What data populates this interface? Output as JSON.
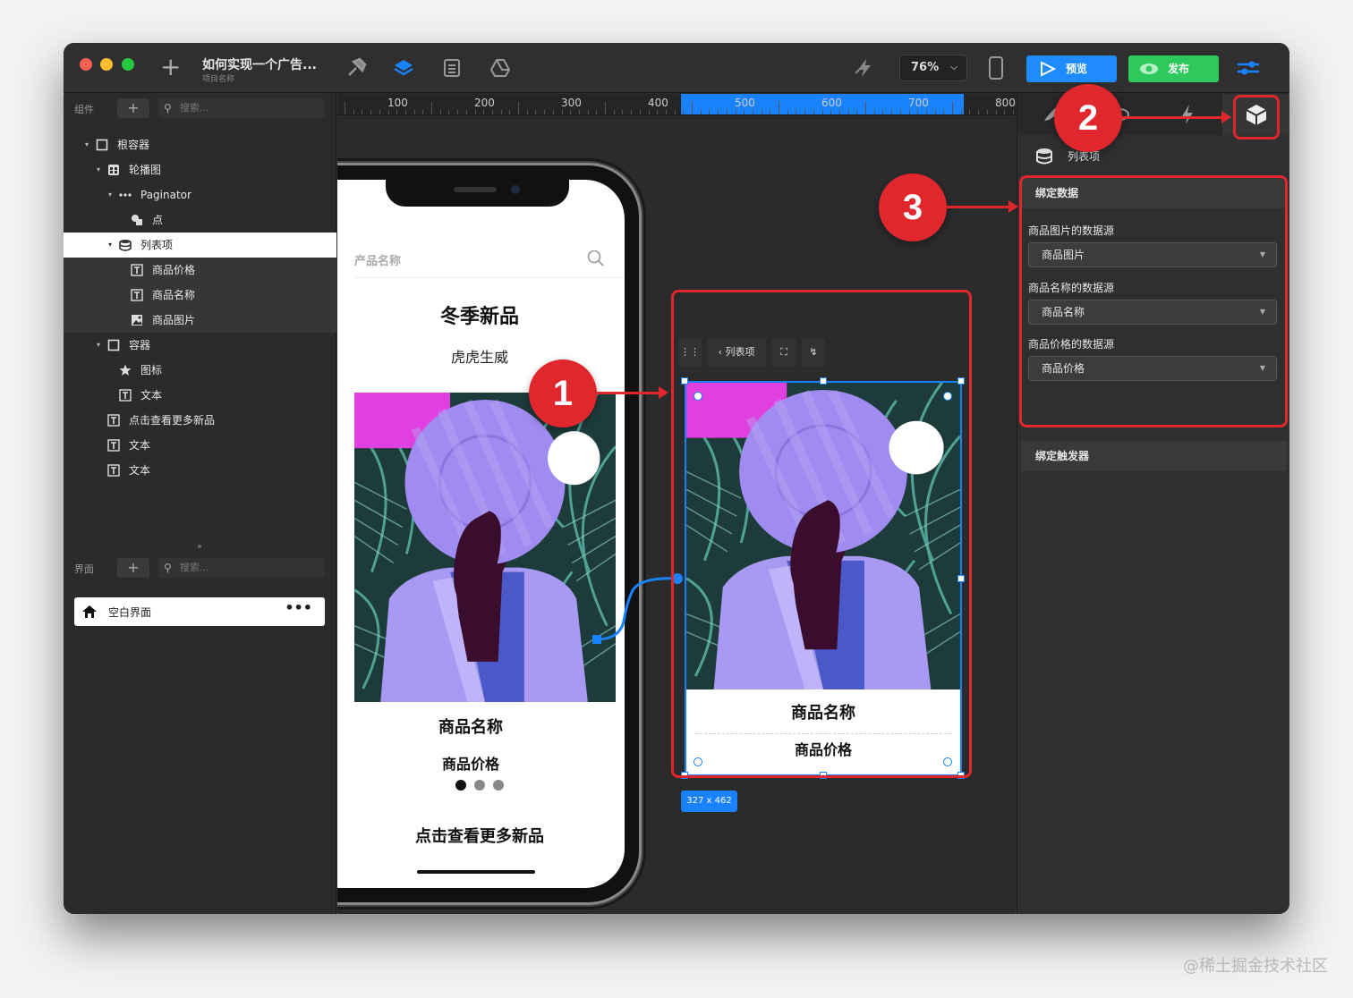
{
  "app": {
    "project_title": "如何实现一个广告...",
    "project_subtitle": "项目名称",
    "zoom": "76%",
    "preview_label": "预览",
    "publish_label": "发布"
  },
  "components_panel": {
    "label": "组件",
    "search_placeholder": "搜索...",
    "tree": [
      {
        "label": "根容器",
        "icon": "square-icon",
        "level": 0,
        "expanded": true
      },
      {
        "label": "轮播图",
        "icon": "carousel-icon",
        "level": 1,
        "expanded": true
      },
      {
        "label": "Paginator",
        "icon": "dots-icon",
        "level": 2,
        "expanded": true
      },
      {
        "label": "点",
        "icon": "shapes-icon",
        "level": 3
      },
      {
        "label": "列表项",
        "icon": "database-icon",
        "level": 2,
        "expanded": true,
        "selected": true
      },
      {
        "label": "商品价格",
        "icon": "text-icon",
        "level": 3
      },
      {
        "label": "商品名称",
        "icon": "text-icon",
        "level": 3
      },
      {
        "label": "商品图片",
        "icon": "image-icon",
        "level": 3
      },
      {
        "label": "容器",
        "icon": "square-icon",
        "level": 1,
        "expanded": true
      },
      {
        "label": "图标",
        "icon": "star-icon",
        "level": 2
      },
      {
        "label": "文本",
        "icon": "text-icon",
        "level": 2
      },
      {
        "label": "点击查看更多新品",
        "icon": "text-icon",
        "level": 1
      },
      {
        "label": "文本",
        "icon": "text-icon",
        "level": 1
      },
      {
        "label": "文本",
        "icon": "text-icon",
        "level": 1
      }
    ]
  },
  "pages_panel": {
    "label": "界面",
    "search_placeholder": "搜索...",
    "items": [
      {
        "label": "空白界面",
        "icon": "home-icon",
        "more": "•••"
      }
    ]
  },
  "ruler": {
    "labels": [
      "100",
      "200",
      "300",
      "400",
      "500",
      "600",
      "700",
      "800"
    ]
  },
  "phone_screen": {
    "search_placeholder": "产品名称",
    "title": "冬季新品",
    "subtitle": "虎虎生威",
    "product_name": "商品名称",
    "product_price": "商品价格",
    "more_link": "点击查看更多新品",
    "page_dots": 3,
    "active_dot": 0
  },
  "component_preview": {
    "toolbar_label": "列表项",
    "product_name": "商品名称",
    "product_price": "商品价格",
    "size": "327 x 462"
  },
  "properties_panel": {
    "component_name": "列表项",
    "bind_section": "绑定数据",
    "fields": [
      {
        "label": "商品图片的数据源",
        "value": "商品图片"
      },
      {
        "label": "商品名称的数据源",
        "value": "商品名称"
      },
      {
        "label": "商品价格的数据源",
        "value": "商品价格"
      }
    ],
    "trigger_section": "绑定触发器"
  },
  "annotations": {
    "badges": [
      "1",
      "2",
      "3"
    ]
  },
  "colors": {
    "accent": "#1a82ff",
    "publish": "#2ec95c",
    "annotation": "#e0272d",
    "magenta": "#e040e0",
    "purple": "#a08cf0",
    "jungle": "#1d3b3a"
  },
  "watermark": "@稀土掘金技术社区"
}
